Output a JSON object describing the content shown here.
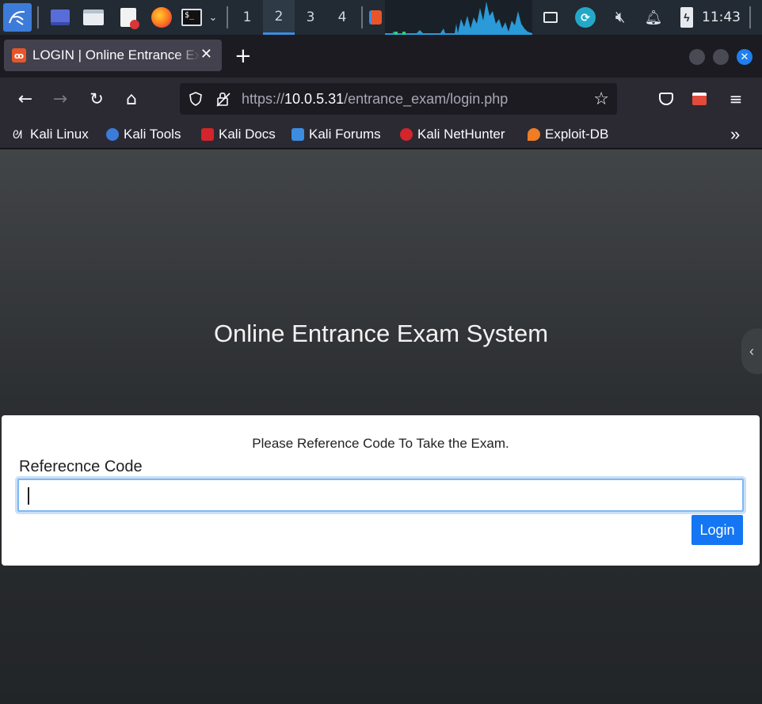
{
  "panel": {
    "workspaces": [
      "1",
      "2",
      "3",
      "4"
    ],
    "active_workspace": "2",
    "clock": "11:43"
  },
  "browser": {
    "tab_title": "LOGIN | Online Entrance Exam System",
    "url_scheme": "https://",
    "url_host": "10.0.5.31",
    "url_path": "/entrance_exam/login.php",
    "bookmarks": [
      "Kali Linux",
      "Kali Tools",
      "Kali Docs",
      "Kali Forums",
      "Kali NetHunter",
      "Exploit-DB"
    ]
  },
  "page": {
    "title": "Online Entrance Exam System",
    "instruction": "Please Reference Code To Take the Exam.",
    "field_label": "Referecnce Code",
    "field_value": "",
    "button_label": "Login"
  },
  "colors": {
    "accent": "#1476f2",
    "panel_bg": "#222a33",
    "toolbar_bg": "#2b2a33",
    "input_focus": "#80b8f0"
  }
}
